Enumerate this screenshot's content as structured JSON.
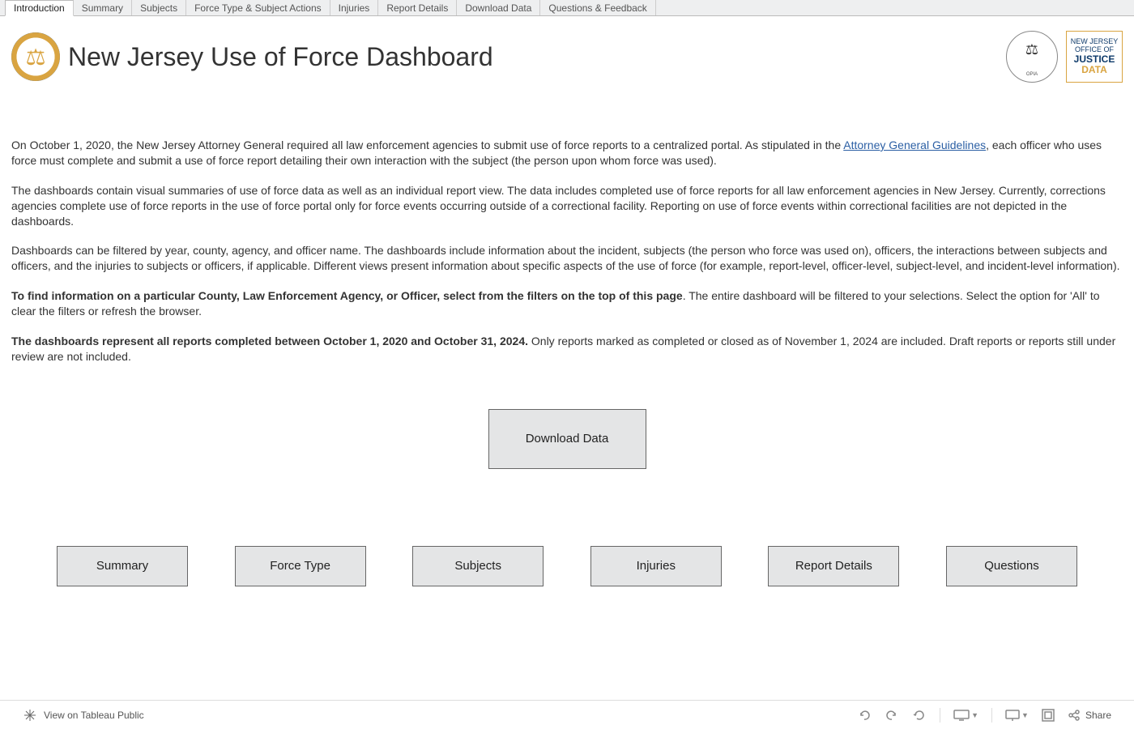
{
  "tabs": [
    {
      "label": "Introduction",
      "active": true
    },
    {
      "label": "Summary",
      "active": false
    },
    {
      "label": "Subjects",
      "active": false
    },
    {
      "label": "Force Type & Subject Actions",
      "active": false
    },
    {
      "label": "Injuries",
      "active": false
    },
    {
      "label": "Report Details",
      "active": false
    },
    {
      "label": "Download Data",
      "active": false
    },
    {
      "label": "Questions & Feedback",
      "active": false
    }
  ],
  "header": {
    "title": "New Jersey Use of Force Dashboard",
    "jd_line1": "NEW JERSEY",
    "jd_line2": "OFFICE OF",
    "jd_line3": "JUSTICE",
    "jd_line4": "DATA"
  },
  "intro": {
    "p1_before": "On October 1, 2020, the New Jersey Attorney General required all law enforcement agencies to submit use of force reports to a centralized portal. As stipulated in the ",
    "p1_link": "Attorney General Guidelines",
    "p1_after": ", each officer who uses force must complete and submit a use of force report detailing their own interaction with the subject (the person upon whom force was used).",
    "p2": "The dashboards contain visual summaries of use of force data as well as an individual report view. The data includes completed use of force reports for all law enforcement agencies in New Jersey. Currently, corrections agencies complete use of force reports in the use of force portal only for force events occurring outside of a correctional facility. Reporting on use of force events within correctional facilities are not depicted in the dashboards.",
    "p3": "Dashboards can be filtered by year, county, agency, and officer name. The dashboards include information about the incident, subjects (the person who force was used on), officers, the interactions between subjects and officers, and the injuries to subjects or officers, if applicable. Different views present information about specific aspects of the use of force (for example, report-level, officer-level, subject-level, and incident-level information).",
    "p4_bold": "To find information on a particular County, Law Enforcement Agency, or Officer, select from the filters on the top of this page",
    "p4_after": ". The entire dashboard will be filtered to your selections. Select the option for 'All' to clear the filters or refresh the browser.",
    "p5_bold": "The dashboards represent all reports completed between October 1, 2020 and October 31, 2024.",
    "p5_after": " Only reports marked as completed or closed as of November 1, 2024 are included. Draft reports or reports still under review are not included."
  },
  "buttons": {
    "download": "Download Data",
    "nav": [
      "Summary",
      "Force Type",
      "Subjects",
      "Injuries",
      "Report Details",
      "Questions"
    ]
  },
  "footer": {
    "view": "View on Tableau Public",
    "share": "Share"
  }
}
